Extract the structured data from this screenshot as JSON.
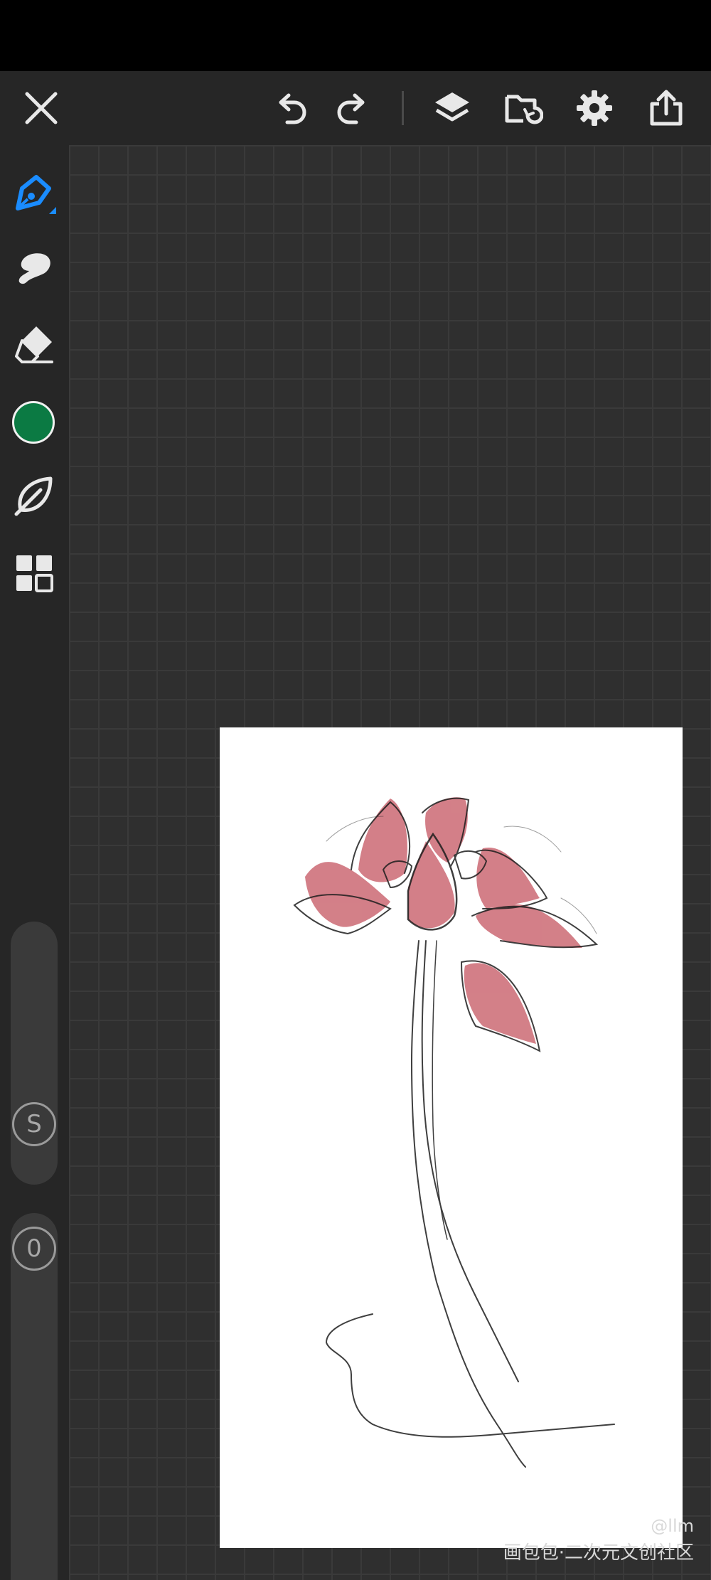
{
  "toolbar": {
    "close_icon": "close-icon",
    "undo_icon": "undo-icon",
    "redo_icon": "redo-icon",
    "layers_icon": "layers-icon",
    "import_icon": "folder-import-icon",
    "settings_icon": "gear-icon",
    "share_icon": "share-icon"
  },
  "sidebar": {
    "tools": [
      {
        "name": "brush",
        "icon": "pen-icon",
        "active": true
      },
      {
        "name": "smudge",
        "icon": "smudge-icon",
        "active": false
      },
      {
        "name": "eraser",
        "icon": "eraser-icon",
        "active": false
      },
      {
        "name": "color",
        "icon": "color-swatch",
        "active": false
      },
      {
        "name": "brush-library",
        "icon": "leaf-icon",
        "active": false
      },
      {
        "name": "more",
        "icon": "grid-icon",
        "active": false
      }
    ],
    "current_color": "#0b7a43",
    "size_slider_label": "S",
    "opacity_slider_label": "0"
  },
  "colors": {
    "accent": "#1a8cff",
    "petal": "#cd6e78",
    "ink": "#1e1e1e"
  },
  "watermark": {
    "handle": "@llm",
    "site": "画包包·二次元文创社区"
  }
}
